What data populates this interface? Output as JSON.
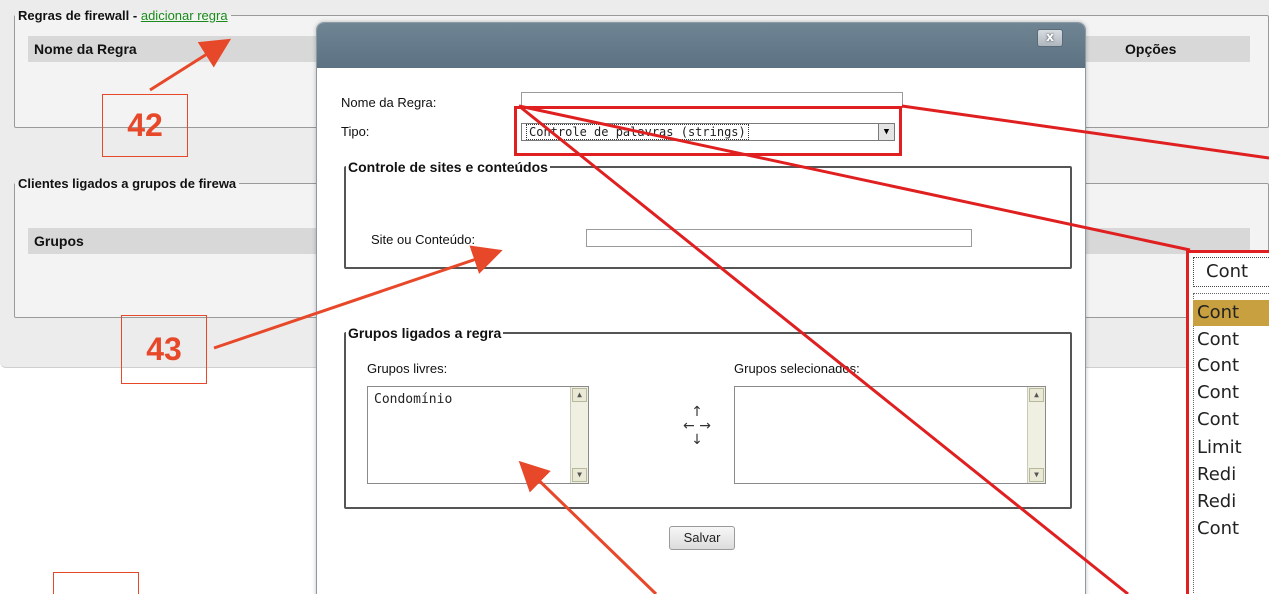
{
  "background": {
    "rules_section": {
      "legend": "Regras de firewall -",
      "add_link": "adicionar regra",
      "col_name": "Nome da Regra",
      "col_options": "Opções"
    },
    "clients_section": {
      "legend": "Clientes ligados a grupos de firewa",
      "col_groups": "Grupos"
    }
  },
  "annotations": {
    "label_42": "42",
    "label_43": "43",
    "color": "#e8482a"
  },
  "dialog": {
    "close_label": "x",
    "rule_name_label": "Nome da Regra:",
    "rule_name_value": "",
    "type_label": "Tipo:",
    "type_value": "Controle de palavras (strings)",
    "sites_fieldset": {
      "legend": "Controle de sites e conteúdos",
      "site_label": "Site ou Conteúdo:",
      "site_value": ""
    },
    "groups_fieldset": {
      "legend": "Grupos ligados a regra",
      "free_label": "Grupos livres:",
      "selected_label": "Grupos selecionados:",
      "free_items": [
        "Condomínio"
      ],
      "selected_items": [],
      "transfer_arrows": "↑\n← →\n↓"
    },
    "save_label": "Salvar"
  },
  "type_dropdown": {
    "current": "Cont",
    "options": [
      "Cont",
      "Cont",
      "Cont",
      "Cont",
      "Cont",
      "Limit",
      "Redi",
      "Redi",
      "Cont"
    ],
    "highlighted_index": 0,
    "highlight_color": "#c8a040"
  }
}
